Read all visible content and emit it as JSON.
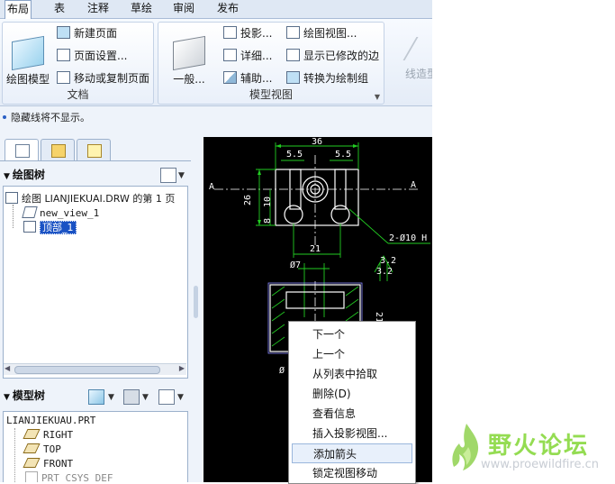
{
  "tabs": [
    {
      "label": "布局",
      "active": true
    },
    {
      "label": "表"
    },
    {
      "label": "注释"
    },
    {
      "label": "草绘"
    },
    {
      "label": "审阅"
    },
    {
      "label": "发布"
    }
  ],
  "ribbon": {
    "document": {
      "group_label": "文档",
      "big_button": "绘图模型",
      "buttons": [
        "新建页面",
        "页面设置...",
        "移动或复制页面"
      ]
    },
    "model_views": {
      "group_label": "模型视图",
      "big_button": "一般...",
      "col1": [
        "投影...",
        "详细...",
        "辅助..."
      ],
      "col2": [
        "绘图视图...",
        "显示已修改的边",
        "转换为绘制组"
      ]
    },
    "partial_button": "线造型"
  },
  "status_message": "隐藏线将不显示。",
  "drawing_tree": {
    "title": "绘图树",
    "nodes": [
      {
        "label": "绘图 LIANJIEKUAI.DRW 的第 1 页"
      },
      {
        "label": "new_view_1"
      },
      {
        "label": "顶部_1",
        "selected": true
      }
    ]
  },
  "model_tree": {
    "title": "模型树",
    "root": "LIANJIEKUAU.PRT",
    "nodes": [
      "RIGHT",
      "TOP",
      "FRONT",
      "PRT_CSYS_DEF"
    ]
  },
  "drawing": {
    "dims": {
      "width_36": "36",
      "slot_left": "5.5",
      "slot_right": "5.5",
      "height_26": "26",
      "h10": "10",
      "h8": "8",
      "w21": "21",
      "dia7": "Ø7",
      "hole_note": "2-Ø10 H",
      "d32a": "3.2",
      "d32b": "3.2",
      "side_a_left": "A",
      "side_a_right": "A",
      "partial_left": "Ø",
      "partial_right": "21"
    }
  },
  "context_menu": {
    "items": [
      {
        "label": "下一个"
      },
      {
        "label": "上一个"
      },
      {
        "label": "从列表中拾取"
      },
      {
        "label": "删除(D)"
      },
      {
        "label": "查看信息"
      },
      {
        "label": "插入投影视图..."
      },
      {
        "label": "添加箭头",
        "highlighted": true
      },
      {
        "label": "锁定视图移动"
      }
    ]
  },
  "watermark": {
    "name": "野火论坛",
    "url": "www.proewildfire.cn"
  }
}
